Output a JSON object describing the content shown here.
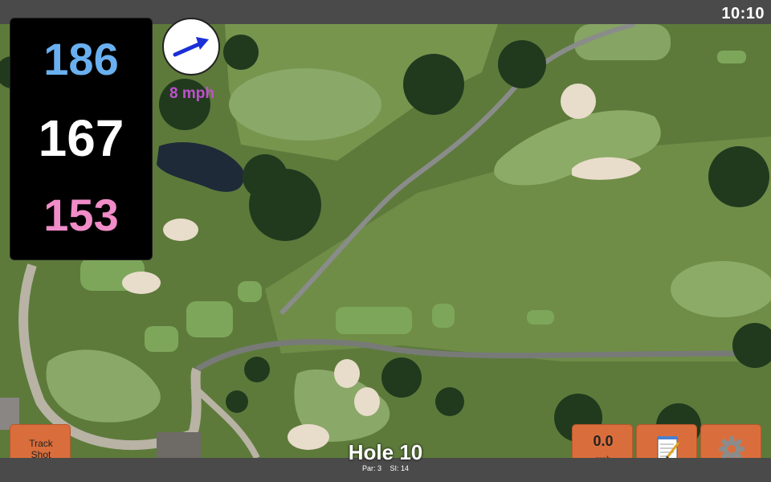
{
  "status_bar": {
    "time": "10:10"
  },
  "distances": {
    "back": "186",
    "middle": "167",
    "front": "153",
    "colors": {
      "back": "#6ab0f0",
      "middle": "#ffffff",
      "front": "#f08cc8"
    }
  },
  "wind": {
    "speed_label": "8 mph",
    "direction_icon": "wind-arrow-icon",
    "color": "#c050d0"
  },
  "hole": {
    "title": "Hole 10",
    "par_label": "Par: 3",
    "si_label": "SI: 14"
  },
  "buttons": {
    "track_shot_line1": "Track",
    "track_shot_line2": "Shot",
    "speed_value": "0.0",
    "speed_unit": "mph",
    "notes_icon": "notepad-icon",
    "settings_icon": "gear-icon"
  },
  "accent": "#d96e3c"
}
